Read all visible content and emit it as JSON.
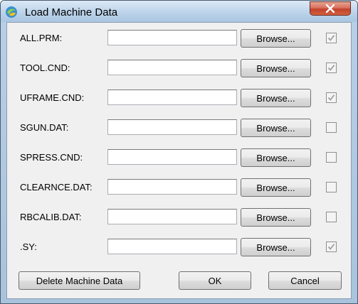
{
  "window": {
    "title": "Load Machine Data"
  },
  "files": [
    {
      "label": "ALL.PRM:",
      "value": "",
      "browse_label": "Browse...",
      "checked": true
    },
    {
      "label": "TOOL.CND:",
      "value": "",
      "browse_label": "Browse...",
      "checked": true
    },
    {
      "label": "UFRAME.CND:",
      "value": "",
      "browse_label": "Browse...",
      "checked": true
    },
    {
      "label": "SGUN.DAT:",
      "value": "",
      "browse_label": "Browse...",
      "checked": false
    },
    {
      "label": "SPRESS.CND:",
      "value": "",
      "browse_label": "Browse...",
      "checked": false
    },
    {
      "label": "CLEARNCE.DAT:",
      "value": "",
      "browse_label": "Browse...",
      "checked": false
    },
    {
      "label": "RBCALIB.DAT:",
      "value": "",
      "browse_label": "Browse...",
      "checked": false
    },
    {
      "label": ".SY:",
      "value": "",
      "browse_label": "Browse...",
      "checked": true
    }
  ],
  "buttons": {
    "delete": "Delete Machine Data",
    "ok": "OK",
    "cancel": "Cancel"
  },
  "colors": {
    "frame": "#b7cfe6",
    "close": "#c2412b",
    "checkmark": "#a0a0a0"
  }
}
